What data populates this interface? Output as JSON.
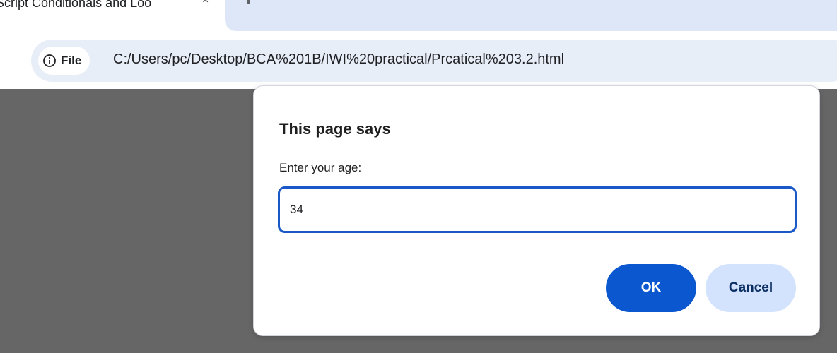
{
  "browser": {
    "tab": {
      "title": "Script Conditionals and Loo",
      "close_icon": "close-icon",
      "close_glyph": "×"
    },
    "omnibox": {
      "site_chip_icon": "info-icon",
      "site_chip_label": "File",
      "url": "C:/Users/pc/Desktop/BCA%201B/IWI%20practical/Prcatical%203.2.html"
    }
  },
  "dialog": {
    "title": "This page says",
    "message": "Enter your age:",
    "input_value": "34",
    "ok_label": "OK",
    "cancel_label": "Cancel"
  },
  "colors": {
    "accent": "#0b57d0",
    "cancel_bg": "#d3e3fd",
    "omnibox_bg": "#e8eef8",
    "overlay": "#666666"
  }
}
